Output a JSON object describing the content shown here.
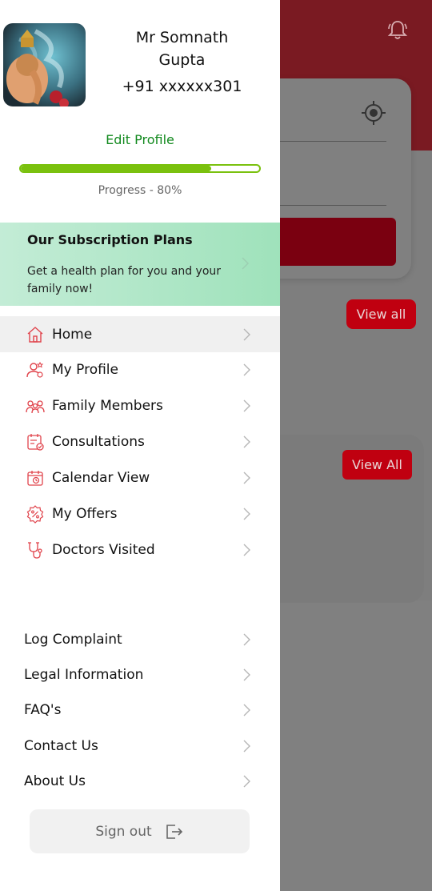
{
  "background": {
    "view_all_1": "View all",
    "view_all_2": "View All"
  },
  "profile": {
    "name_line1": "Mr Somnath",
    "name_line2": "Gupta",
    "phone": "+91 xxxxxx301",
    "edit_label": "Edit Profile",
    "progress_value": 0.8,
    "progress_text": "Progress - 80%"
  },
  "subscription": {
    "title": "Our Subscription Plans",
    "description": "Get a health plan for you and your family now!"
  },
  "menu": [
    {
      "label": "Home",
      "icon": "home-icon"
    },
    {
      "label": "My Profile",
      "icon": "user-profile-icon"
    },
    {
      "label": "Family Members",
      "icon": "family-icon"
    },
    {
      "label": "Consultations",
      "icon": "consultation-icon"
    },
    {
      "label": "Calendar View",
      "icon": "calendar-icon"
    },
    {
      "label": "My Offers",
      "icon": "offer-icon"
    },
    {
      "label": "Doctors Visited",
      "icon": "stethoscope-icon"
    }
  ],
  "secondary_menu": [
    {
      "label": "Log Complaint"
    },
    {
      "label": "Legal Information"
    },
    {
      "label": "FAQ's"
    },
    {
      "label": "Contact Us"
    },
    {
      "label": "About Us"
    }
  ],
  "signout": {
    "label": "Sign out",
    "icon": "logout-icon"
  },
  "colors": {
    "accent_red": "#e0434b",
    "progress_green": "#7ac10e",
    "edit_green": "#138a1f"
  }
}
